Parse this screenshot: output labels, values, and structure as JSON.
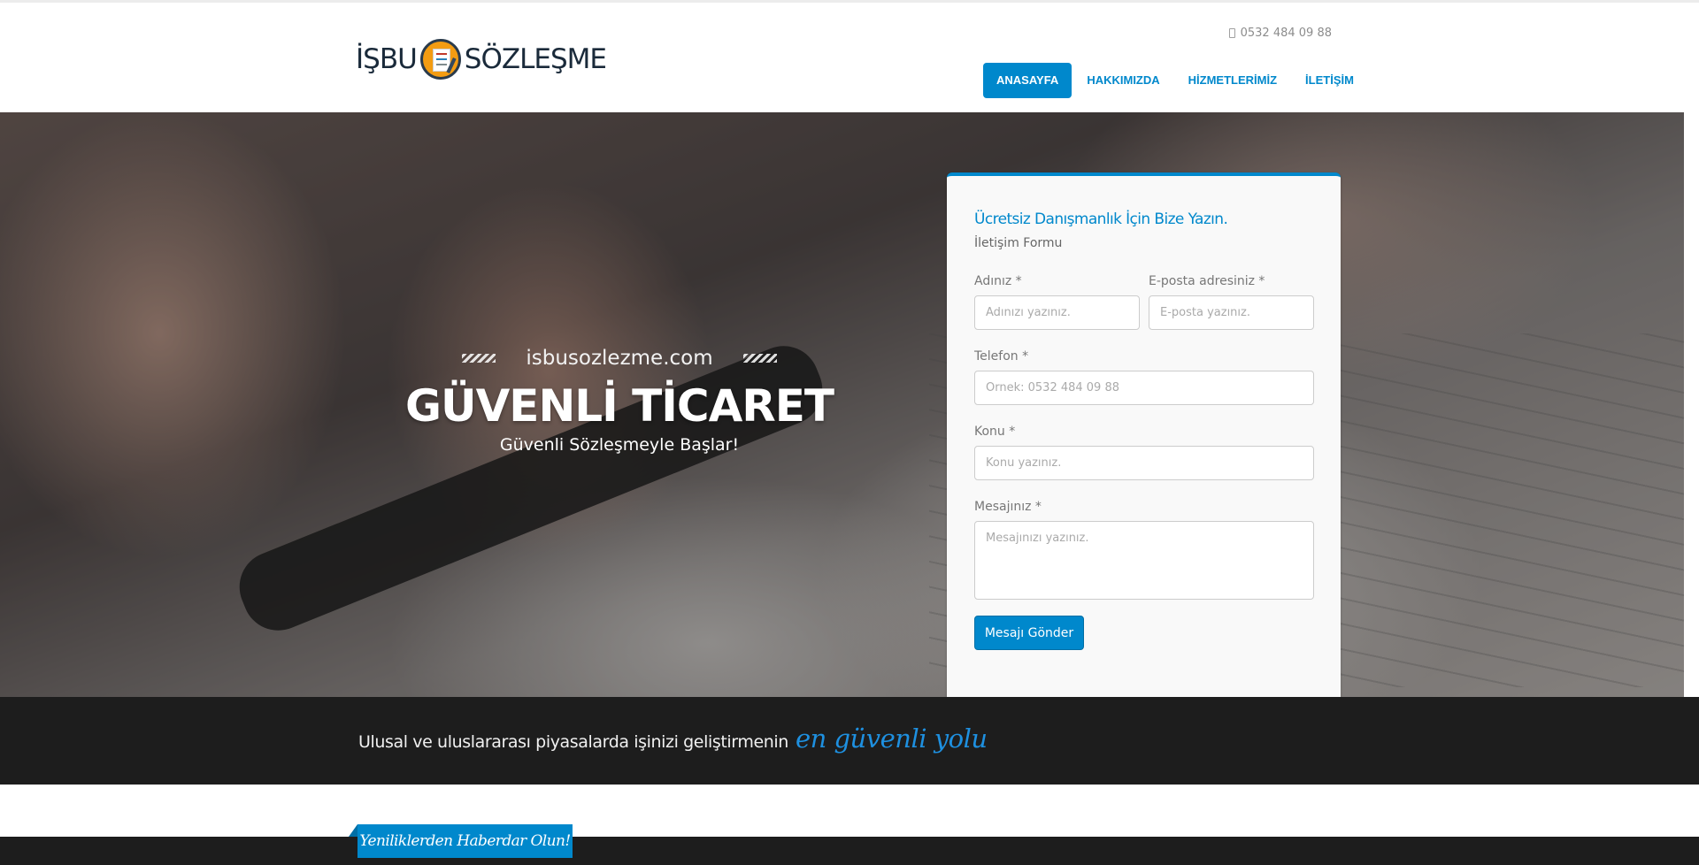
{
  "header": {
    "logo": {
      "left_text": "İŞBU",
      "right_text": "SÖZLEŞME",
      "emblem_icon": "contract-document-icon"
    },
    "phone": {
      "icon": "mobile-phone-icon",
      "number": "0532 484 09 88"
    },
    "nav": [
      {
        "label": "ANASAYFA",
        "active": true
      },
      {
        "label": "HAKKIMIZDA",
        "active": false
      },
      {
        "label": "HİZMETLERİMİZ",
        "active": false
      },
      {
        "label": "İLETİŞİM",
        "active": false
      }
    ]
  },
  "hero": {
    "site": "isbusozlezme.com",
    "title": "GÜVENLİ TİCARET",
    "subtitle": "Güvenli Sözleşmeyle Başlar!"
  },
  "form": {
    "title": "Ücretsiz Danışmanlık İçin Bize Yazın.",
    "subtitle": "İletişim Formu",
    "name": {
      "label": "Adınız *",
      "placeholder": "Adınızı yazınız."
    },
    "email": {
      "label": "E-posta adresiniz *",
      "placeholder": "E-posta yazınız."
    },
    "phone": {
      "label": "Telefon *",
      "placeholder": "Örnek: 0532 484 09 88"
    },
    "subject": {
      "label": "Konu *",
      "placeholder": "Konu yazınız."
    },
    "message": {
      "label": "Mesajınız *",
      "placeholder": "Mesajınızı yazınız."
    },
    "submit": "Mesajı Gönder"
  },
  "band": {
    "text": "Ulusal ve uluslararası piyasalarda işinizi geliştirmenin",
    "accent": "en güvenli yolu"
  },
  "news": {
    "tab": "Yeniliklerden Haberdar Olun!"
  },
  "colors": {
    "primary": "#0088cc",
    "dark": "#1d1d1d"
  }
}
